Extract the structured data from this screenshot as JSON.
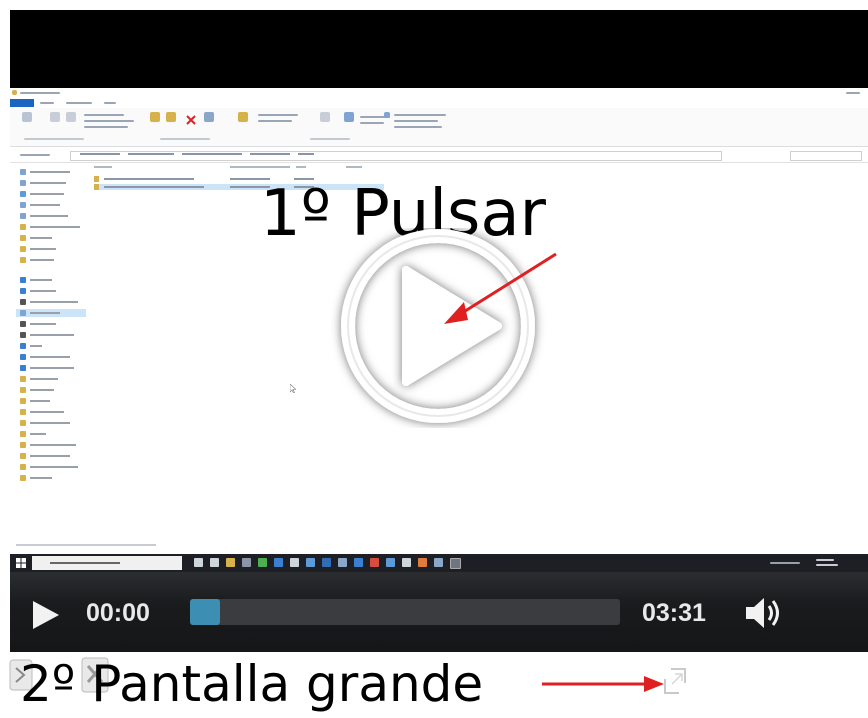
{
  "overlay": {
    "step1": "1º Pulsar",
    "step2": "2º Pantalla grande"
  },
  "player": {
    "current_time": "00:00",
    "duration": "03:31",
    "progress": 0.0,
    "accent_color": "#3c8fb3",
    "arrow_color": "#e02020"
  },
  "icons": {
    "play": "play-icon",
    "volume": "volume-icon",
    "fullscreen": "fullscreen-icon",
    "big_play": "big-play-icon"
  }
}
